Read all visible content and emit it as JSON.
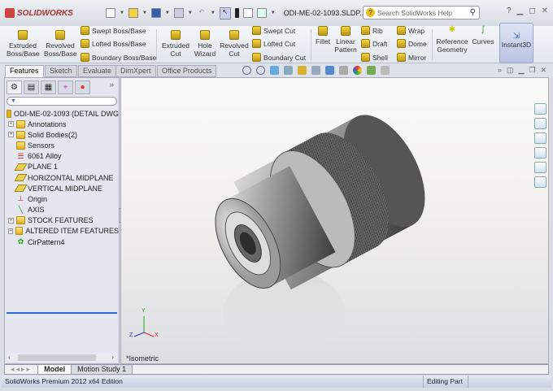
{
  "app": {
    "brand": "SOLIDWORKS",
    "document_title": "ODI-ME-02-1093.SLDP...",
    "search_placeholder": "Search SolidWorks Help"
  },
  "ribbon": {
    "extruded_boss": [
      "Extruded",
      "Boss/Base"
    ],
    "revolved_boss": [
      "Revolved",
      "Boss/Base"
    ],
    "swept_boss": "Swept Boss/Base",
    "lofted_boss": "Lofted Boss/Base",
    "boundary_boss": "Boundary Boss/Base",
    "extruded_cut": [
      "Extruded",
      "Cut"
    ],
    "hole_wizard": [
      "Hole",
      "Wizard"
    ],
    "revolved_cut": [
      "Revolved",
      "Cut"
    ],
    "swept_cut": "Swept Cut",
    "lofted_cut": "Lofted Cut",
    "boundary_cut": "Boundary Cut",
    "fillet": "Fillet",
    "linear_pattern": [
      "Linear",
      "Pattern"
    ],
    "rib": "Rib",
    "draft": "Draft",
    "shell": "Shell",
    "wrap": "Wrap",
    "dome": "Dome",
    "mirror": "Mirror",
    "reference_geometry": [
      "Reference",
      "Geometry"
    ],
    "curves": "Curves",
    "instant3d": "Instant3D"
  },
  "tabs": [
    "Features",
    "Sketch",
    "Evaluate",
    "DimXpert",
    "Office Products"
  ],
  "tree": {
    "root": "ODI-ME-02-1093  (DETAIL DWG",
    "items": [
      {
        "label": "Annotations",
        "expand": true,
        "icon": "annotations-folder"
      },
      {
        "label": "Solid Bodies(2)",
        "expand": true,
        "icon": "solid-bodies-folder"
      },
      {
        "label": "Sensors",
        "expand": false,
        "icon": "sensors-folder"
      },
      {
        "label": "6061 Alloy",
        "expand": false,
        "icon": "material"
      },
      {
        "label": "PLANE 1",
        "expand": false,
        "icon": "plane"
      },
      {
        "label": "HORIZONTAL MIDPLANE",
        "expand": false,
        "icon": "plane"
      },
      {
        "label": "VERTICAL MIDPLANE",
        "expand": false,
        "icon": "plane"
      },
      {
        "label": "Origin",
        "expand": false,
        "icon": "origin"
      },
      {
        "label": "AXIS",
        "expand": false,
        "icon": "axis"
      },
      {
        "label": "STOCK FEATURES",
        "expand": true,
        "icon": "folder"
      },
      {
        "label": "ALTERED ITEM FEATURES",
        "expand": true,
        "icon": "folder"
      },
      {
        "label": "CirPattern4",
        "expand": false,
        "icon": "circular-pattern"
      }
    ]
  },
  "viewport": {
    "view_name": "*Isometric",
    "triad": {
      "x": "X",
      "y": "Y",
      "z": "Z"
    }
  },
  "bottom_tabs": [
    "Model",
    "Motion Study 1"
  ],
  "status": {
    "edition": "SolidWorks Premium 2012 x64 Edition",
    "mode": "Editing Part"
  }
}
